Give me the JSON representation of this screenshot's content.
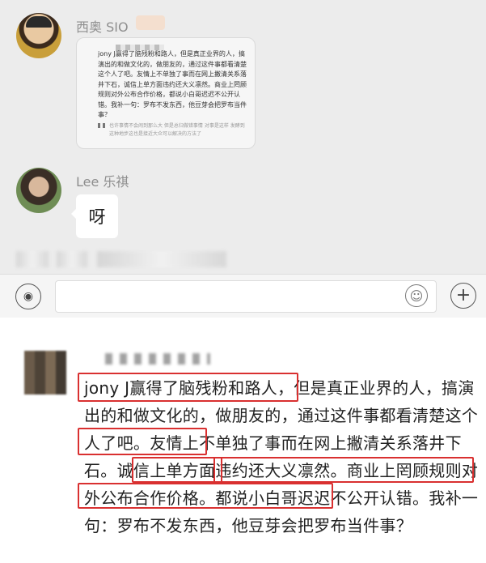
{
  "chat": {
    "messages": [
      {
        "sender": "西奥 SIO",
        "type": "image",
        "image_text": "jony J赢得了脑残粉和路人，但是真正业界的人，搞演出的和做文化的，做朋友的，通过这件事都看清楚这个人了吧。友情上不单独了事而在网上撇清关系落井下石，诚信上单方面违约还大义凛然。商业上罔顾规则对外公布合作价格，都说小白哥迟迟不公开认错。我补一句：罗布不发东西，他豆芽会把罗布当件事？",
        "image_subtext": "也许事情不会闹到那么大 但是总归做错事情 对事是这样 发酵到这种地步这也是接近大众可以解决的方法了"
      },
      {
        "sender": "Lee 乐祺",
        "type": "text",
        "text": "呀"
      }
    ],
    "input": {
      "placeholder": ""
    }
  },
  "zoomed_comment": {
    "text": "jony J赢得了脑残粉和路人，但是真正业界的人，搞演出的和做文化的，做朋友的，通过这件事都看清楚这个人了吧。友情上不单独了事而在网上撇清关系落井下石。诚信上单方面违约还大义凛然。商业上罔顾规则对外公布合作价格。都说小白哥迟迟不公开认错。我补一句：罗布不发东西，他豆芽会把罗布当件事？"
  },
  "icons": {
    "voice": "voice-icon",
    "emoji": "emoji-icon",
    "plus": "plus-icon"
  },
  "colors": {
    "chat_bg": "#ececec",
    "highlight": "#d93030"
  }
}
